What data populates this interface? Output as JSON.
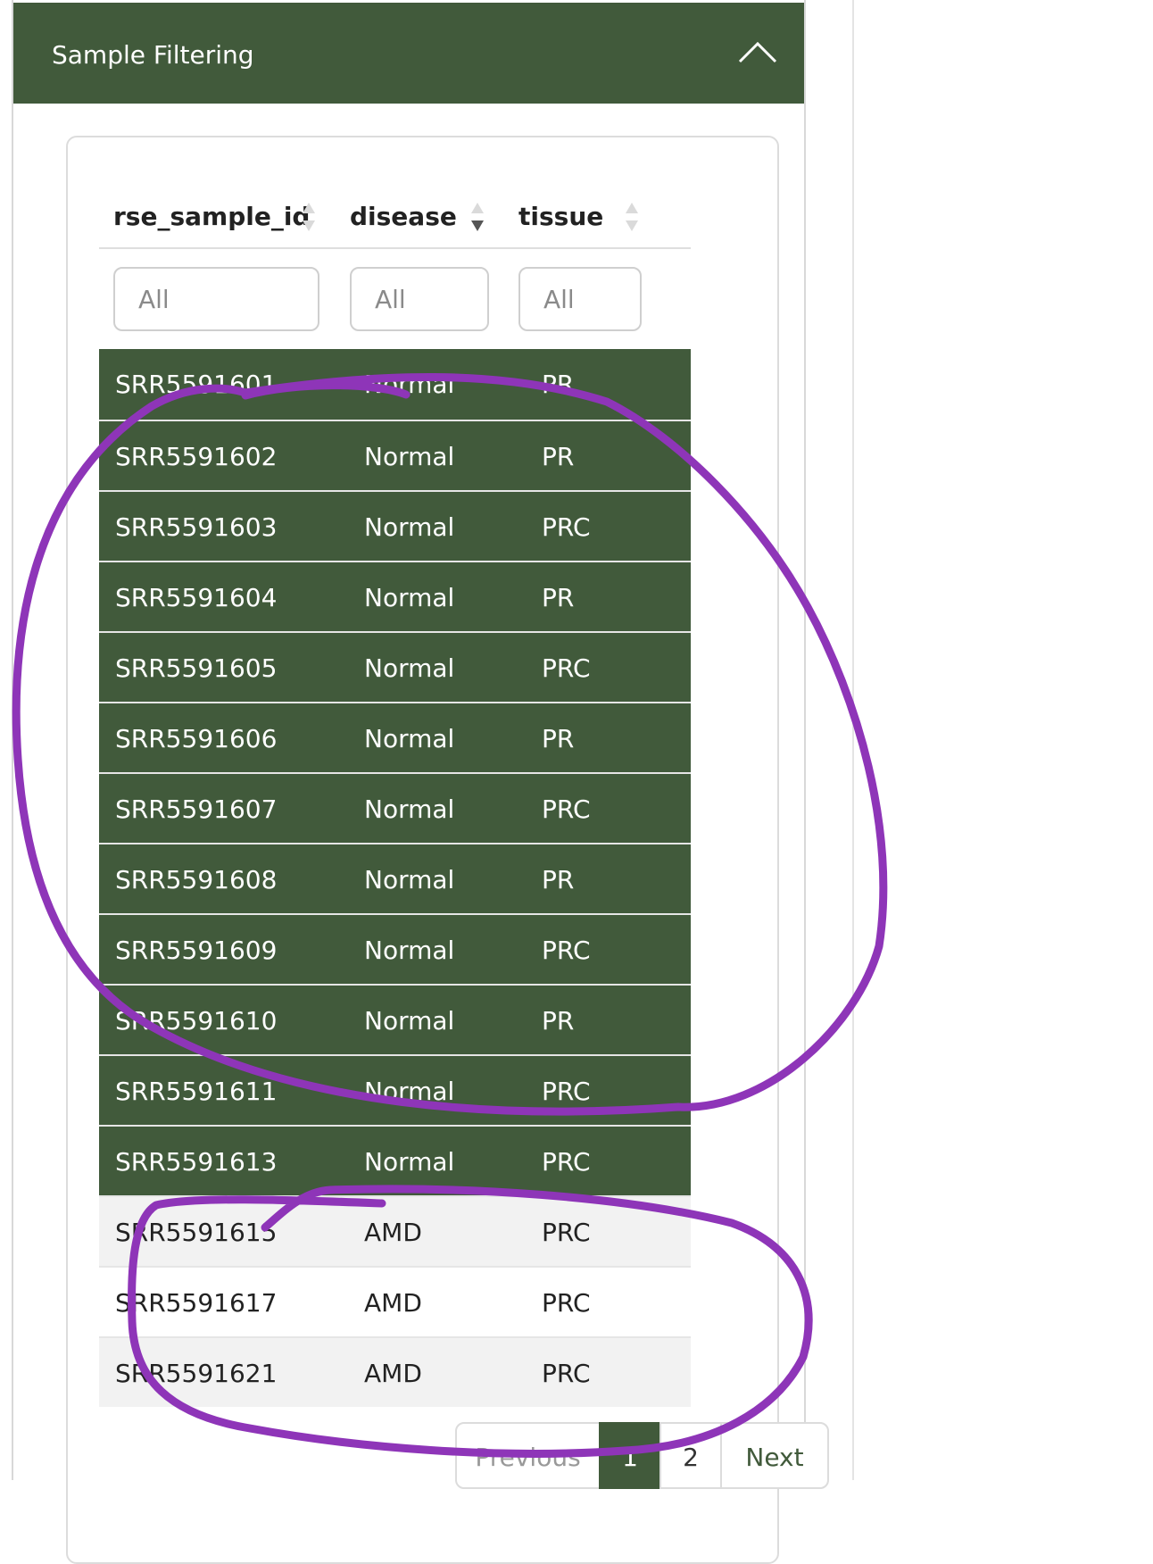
{
  "panel": {
    "title": "Sample Filtering",
    "toggle_icon": "chevron-up-icon"
  },
  "table": {
    "columns": [
      {
        "label": "rse_sample_id",
        "sort": "none"
      },
      {
        "label": "disease",
        "sort": "descending"
      },
      {
        "label": "tissue",
        "sort": "none"
      }
    ],
    "filter_placeholders": [
      "All",
      "All",
      "All"
    ],
    "rows": [
      {
        "id": "SRR5591601",
        "disease": "Normal",
        "tissue": "PR",
        "selected": true
      },
      {
        "id": "SRR5591602",
        "disease": "Normal",
        "tissue": "PR",
        "selected": true
      },
      {
        "id": "SRR5591603",
        "disease": "Normal",
        "tissue": "PRC",
        "selected": true
      },
      {
        "id": "SRR5591604",
        "disease": "Normal",
        "tissue": "PR",
        "selected": true
      },
      {
        "id": "SRR5591605",
        "disease": "Normal",
        "tissue": "PRC",
        "selected": true
      },
      {
        "id": "SRR5591606",
        "disease": "Normal",
        "tissue": "PR",
        "selected": true
      },
      {
        "id": "SRR5591607",
        "disease": "Normal",
        "tissue": "PRC",
        "selected": true
      },
      {
        "id": "SRR5591608",
        "disease": "Normal",
        "tissue": "PR",
        "selected": true
      },
      {
        "id": "SRR5591609",
        "disease": "Normal",
        "tissue": "PRC",
        "selected": true
      },
      {
        "id": "SRR5591610",
        "disease": "Normal",
        "tissue": "PR",
        "selected": true
      },
      {
        "id": "SRR5591611",
        "disease": "Normal",
        "tissue": "PRC",
        "selected": true
      },
      {
        "id": "SRR5591613",
        "disease": "Normal",
        "tissue": "PRC",
        "selected": true
      },
      {
        "id": "SRR5591615",
        "disease": "AMD",
        "tissue": "PRC",
        "selected": false
      },
      {
        "id": "SRR5591617",
        "disease": "AMD",
        "tissue": "PRC",
        "selected": false
      },
      {
        "id": "SRR5591621",
        "disease": "AMD",
        "tissue": "PRC",
        "selected": false
      }
    ]
  },
  "pagination": {
    "previous_label": "Previous",
    "pages": [
      "1",
      "2"
    ],
    "current_page": "1",
    "next_label": "Next"
  },
  "colors": {
    "header_green": "#415a3b",
    "selected_row": "#415a3b",
    "annotation_purple": "#8e35b8"
  }
}
